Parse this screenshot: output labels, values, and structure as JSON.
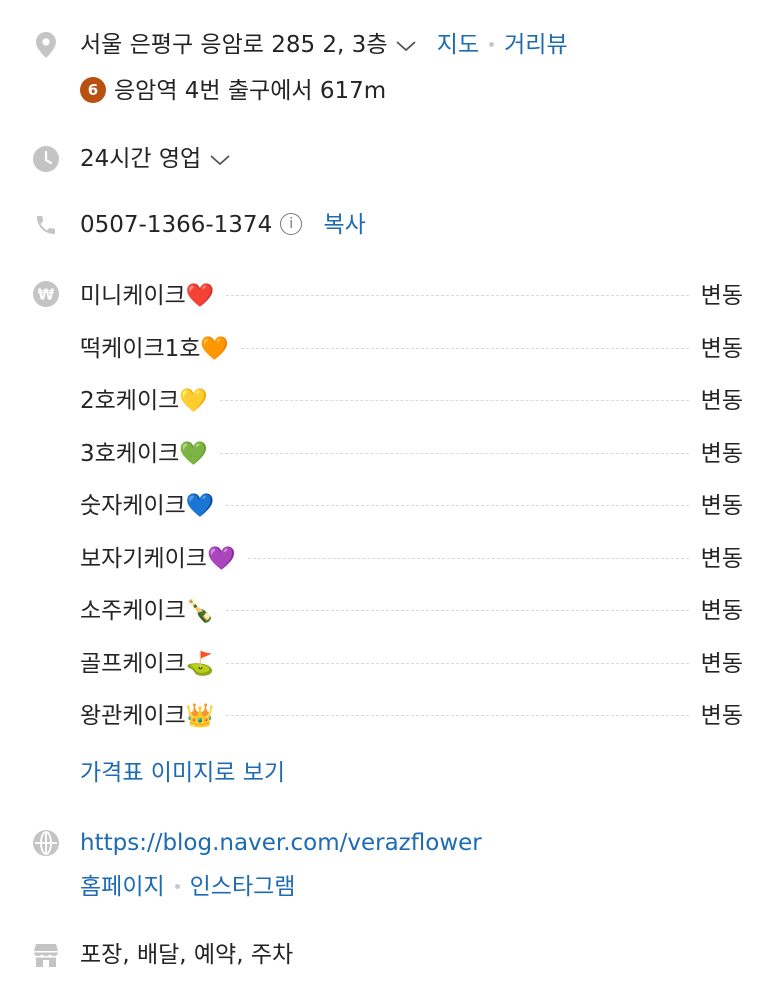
{
  "address": {
    "text": "서울 은평구 응암로 285 2, 3층",
    "map_link": "지도",
    "street_view_link": "거리뷰",
    "subway_line": "6",
    "subway_line_color": "#b8510f",
    "subway_text": "응암역 4번 출구에서 617m"
  },
  "hours": {
    "text": "24시간 영업"
  },
  "phone": {
    "number": "0507-1366-1374",
    "info_icon": "i",
    "copy_label": "복사"
  },
  "menu": {
    "items": [
      {
        "name": "미니케이크❤️",
        "price": "변동"
      },
      {
        "name": "떡케이크1호🧡",
        "price": "변동"
      },
      {
        "name": "2호케이크💛",
        "price": "변동"
      },
      {
        "name": "3호케이크💚",
        "price": "변동"
      },
      {
        "name": "숫자케이크💙",
        "price": "변동"
      },
      {
        "name": "보자기케이크💜",
        "price": "변동"
      },
      {
        "name": "소주케이크🍾",
        "price": "변동"
      },
      {
        "name": "골프케이크⛳",
        "price": "변동"
      },
      {
        "name": "왕관케이크👑",
        "price": "변동"
      }
    ],
    "price_image_link": "가격표 이미지로 보기"
  },
  "website": {
    "url": "https://blog.naver.com/verazflower",
    "homepage_link": "홈페이지",
    "instagram_link": "인스타그램"
  },
  "amenities": {
    "text": "포장, 배달, 예약, 주차"
  },
  "colors": {
    "link": "#1c6bb3",
    "icon": "#c4c4c4",
    "text": "#242424"
  }
}
